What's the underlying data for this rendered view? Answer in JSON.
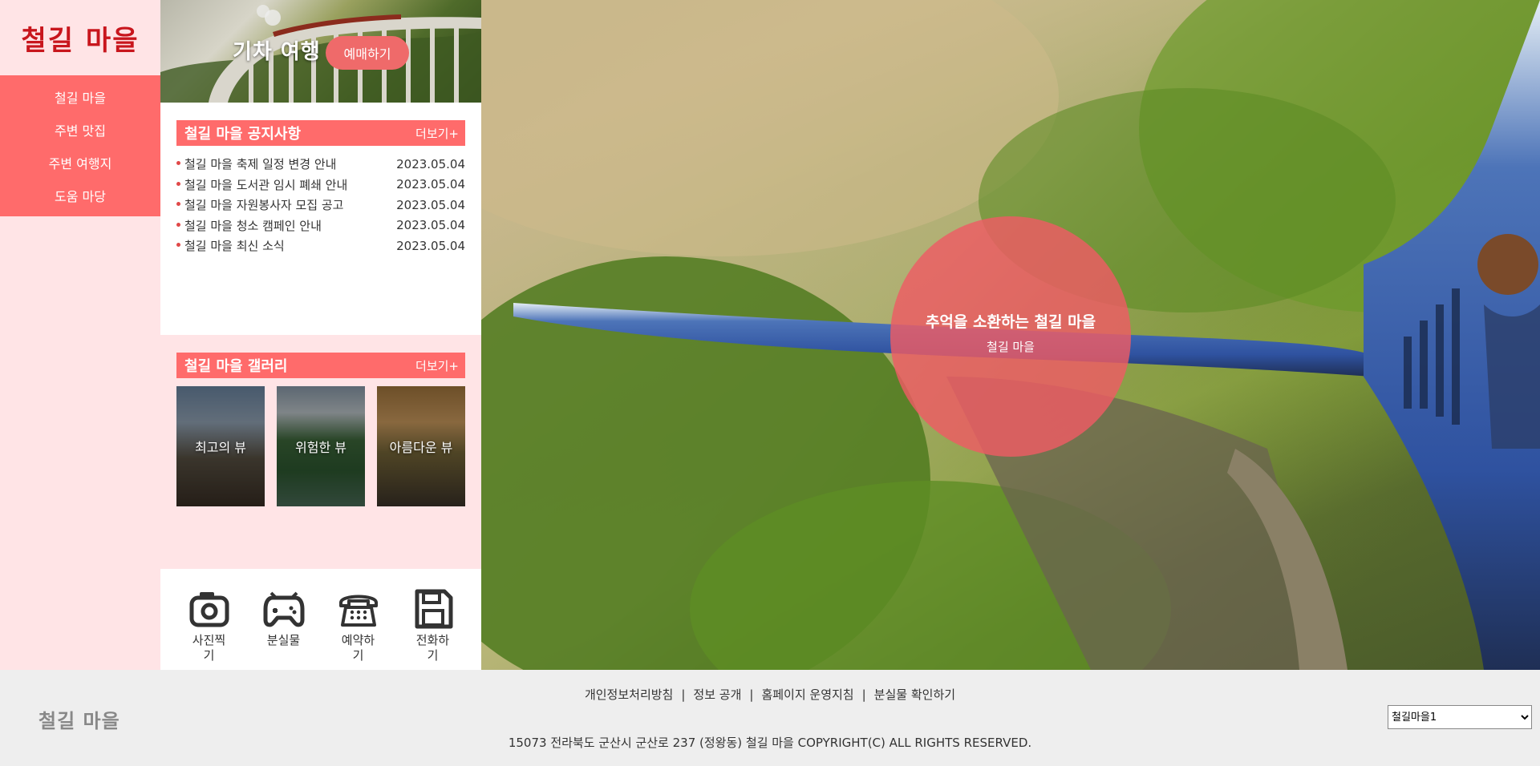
{
  "sidebar": {
    "logo": "철길 마을",
    "items": [
      {
        "label": "철길 마을"
      },
      {
        "label": "주변 맛집"
      },
      {
        "label": "주변 여행지"
      },
      {
        "label": "도움 마당"
      }
    ]
  },
  "banner": {
    "title": "기차 여행",
    "button": "예매하기"
  },
  "notice": {
    "title": "철길 마을 공지사항",
    "more": "더보기+",
    "items": [
      {
        "title": "철길 마을 축제 일정 변경 안내",
        "date": "2023.05.04"
      },
      {
        "title": "철길 마을 도서관 임시 폐쇄 안내",
        "date": "2023.05.04"
      },
      {
        "title": "철길 마을 자원봉사자 모집 공고",
        "date": "2023.05.04"
      },
      {
        "title": "철길 마을 청소 캠페인 안내",
        "date": "2023.05.04"
      },
      {
        "title": "철길 마을 최신 소식",
        "date": "2023.05.04"
      }
    ]
  },
  "gallery": {
    "title": "철길 마을 갤러리",
    "more": "더보기+",
    "items": [
      {
        "label": "최고의 뷰"
      },
      {
        "label": "위험한 뷰"
      },
      {
        "label": "아름다운 뷰"
      }
    ]
  },
  "quick": [
    {
      "label": "사진찍기",
      "icon": "camera-icon"
    },
    {
      "label": "분실물",
      "icon": "gamepad-icon"
    },
    {
      "label": "예약하기",
      "icon": "telephone-icon"
    },
    {
      "label": "전화하기",
      "icon": "floppy-disk-icon"
    }
  ],
  "hero": {
    "title": "추억을 소환하는 철길 마을",
    "subtitle": "철길 마을",
    "accent": "#ee5c64"
  },
  "footer": {
    "logo": "철길 마을",
    "links": [
      {
        "label": "개인정보처리방침"
      },
      {
        "label": "정보 공개"
      },
      {
        "label": "홈페이지 운영지침"
      },
      {
        "label": "분실물 확인하기"
      }
    ],
    "separator": "|",
    "address": "15073 전라북도 군산시 군산로 237 (정왕동) 철길 마을 COPYRIGHT(C) ALL RIGHTS RESERVED.",
    "select": {
      "value": "철길마을1"
    }
  },
  "colors": {
    "primary": "#ff6b6b",
    "logo": "#c8161d",
    "pinkBg": "#ffe4e6"
  }
}
